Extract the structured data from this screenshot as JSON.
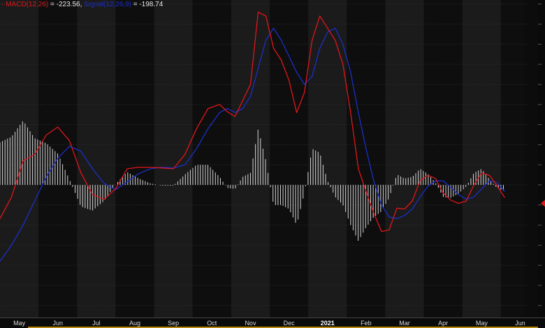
{
  "legend": {
    "macd_name": "MACD(12,26)",
    "macd_value": "= -223.56,",
    "signal_name": "Signal(12,26,9)",
    "signal_value": "= -198.74"
  },
  "colors": {
    "background": "#0c0c0c",
    "band_light": "#1b1b1b",
    "band_dark": "#0e0e0e",
    "grid": "#2e2e2e",
    "macd": "#e0161b",
    "signal": "#1b2fc8",
    "histogram": "#d8d8d8",
    "marker": "#e0161b",
    "axis_highlight": "#b8860b"
  },
  "chart_data": {
    "type": "line",
    "title": "",
    "xlabel": "",
    "ylabel": "",
    "x_tick_labels": [
      "May",
      "Jun",
      "Jul",
      "Aug",
      "Sep",
      "Oct",
      "Nov",
      "Dec",
      "2021",
      "Feb",
      "Mar",
      "Apr",
      "May",
      "Jun"
    ],
    "x_tick_positions": [
      0.5,
      1.5,
      2.5,
      3.5,
      4.5,
      5.5,
      6.5,
      7.5,
      8.5,
      9.5,
      10.5,
      11.5,
      12.5,
      13.5
    ],
    "bold_tick": "2021",
    "xlim": [
      0,
      13.6
    ],
    "ylim": [
      -1650,
      2300
    ],
    "grid": true,
    "zero_line": 0,
    "current_marker_value": -230,
    "series": [
      {
        "name": "MACD(12,26)",
        "x": [
          0,
          0.3,
          0.6,
          0.9,
          1.2,
          1.5,
          1.8,
          2.1,
          2.4,
          2.7,
          3.0,
          3.3,
          3.6,
          3.9,
          4.2,
          4.5,
          4.8,
          5.1,
          5.4,
          5.7,
          5.9,
          6.1,
          6.3,
          6.5,
          6.7,
          6.9,
          7.1,
          7.3,
          7.5,
          7.7,
          7.9,
          8.1,
          8.3,
          8.5,
          8.7,
          8.9,
          9.1,
          9.3,
          9.5,
          9.7,
          9.9,
          10.1,
          10.3,
          10.5,
          10.7,
          10.9,
          11.1,
          11.3,
          11.5,
          11.7,
          11.9,
          12.1,
          12.3,
          12.5,
          12.7,
          12.9,
          13.1
        ],
        "y": [
          -420,
          -150,
          300,
          380,
          620,
          720,
          550,
          150,
          -120,
          -180,
          -50,
          200,
          220,
          220,
          210,
          200,
          380,
          700,
          950,
          1000,
          910,
          850,
          1050,
          1250,
          2150,
          2100,
          1700,
          1550,
          1300,
          900,
          1150,
          1800,
          2100,
          1950,
          1800,
          1500,
          900,
          200,
          -80,
          -350,
          -580,
          -560,
          -290,
          -300,
          -200,
          50,
          120,
          80,
          -100,
          -190,
          -230,
          -200,
          0,
          150,
          120,
          -10,
          -160
        ],
        "color": "#e0161b"
      },
      {
        "name": "Signal(12,26,9)",
        "x": [
          0,
          0.3,
          0.6,
          0.9,
          1.2,
          1.5,
          1.8,
          2.1,
          2.4,
          2.7,
          3.0,
          3.3,
          3.6,
          3.9,
          4.2,
          4.5,
          4.8,
          5.1,
          5.4,
          5.7,
          5.9,
          6.1,
          6.3,
          6.5,
          6.7,
          6.9,
          7.1,
          7.3,
          7.5,
          7.7,
          7.9,
          8.1,
          8.3,
          8.5,
          8.7,
          8.9,
          9.1,
          9.3,
          9.5,
          9.7,
          9.9,
          10.1,
          10.3,
          10.5,
          10.7,
          10.9,
          11.1,
          11.3,
          11.5,
          11.7,
          11.9,
          12.1,
          12.3,
          12.5,
          12.7,
          12.9,
          13.1
        ],
        "y": [
          -950,
          -750,
          -500,
          -200,
          100,
          330,
          480,
          420,
          200,
          20,
          -60,
          40,
          140,
          200,
          220,
          210,
          250,
          450,
          700,
          900,
          950,
          900,
          950,
          1100,
          1450,
          1800,
          1950,
          1800,
          1600,
          1400,
          1250,
          1350,
          1700,
          1900,
          1950,
          1750,
          1400,
          900,
          450,
          50,
          -250,
          -400,
          -420,
          -380,
          -300,
          -150,
          -20,
          50,
          50,
          -30,
          -120,
          -180,
          -150,
          -50,
          50,
          30,
          -80
        ],
        "color": "#1b2fc8"
      }
    ]
  }
}
